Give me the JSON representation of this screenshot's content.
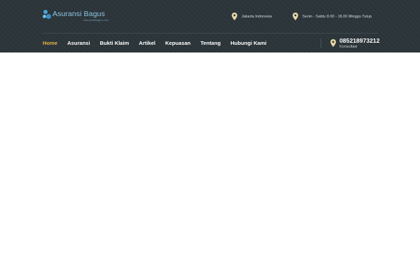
{
  "logo": {
    "name": "Asuransi Bagus",
    "sub": "AsuransiBagus.com"
  },
  "header_info": {
    "location": "Jakarta Indonesia",
    "hours": "Senin - Sabtu 8.00 - 18.00 Minggu Tutup"
  },
  "nav": {
    "items": [
      {
        "label": "Home",
        "active": true
      },
      {
        "label": "Asuransi",
        "active": false
      },
      {
        "label": "Bukti Klaim",
        "active": false
      },
      {
        "label": "Artikel",
        "active": false
      },
      {
        "label": "Kepuasan",
        "active": false
      },
      {
        "label": "Tentang",
        "active": false
      },
      {
        "label": "Hubungi Kami",
        "active": false
      }
    ]
  },
  "contact": {
    "phone": "085218973212",
    "label": "Konsultasi"
  },
  "colors": {
    "header_bg": "#2b3438",
    "accent": "#e5b545",
    "pin": "#e9d8a6",
    "logo_blue": "#4aa3d8"
  },
  "icons": {
    "location": "map-pin-icon",
    "hours": "map-pin-icon",
    "phone": "map-pin-icon"
  }
}
